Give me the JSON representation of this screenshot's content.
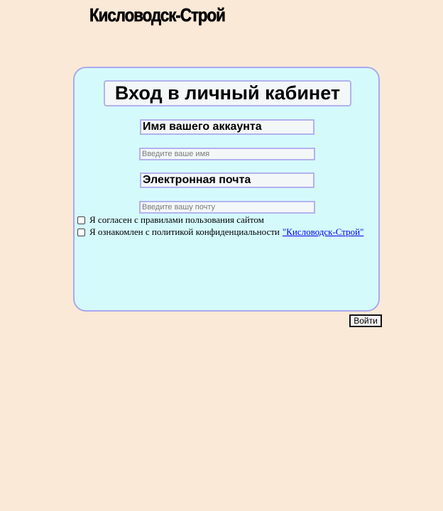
{
  "header": {
    "site_title": "Кисловодск-Строй"
  },
  "login_form": {
    "heading": "Вход в личный кабинет",
    "name_label": "Имя вашего аккаунта",
    "name_placeholder": "Введите ваше имя",
    "name_value": "",
    "email_label": "Электронная почта",
    "email_placeholder": "Введите вашу почту",
    "email_value": "",
    "agree_rules": {
      "label": "Я согласен с правилами пользования сайтом",
      "checked": false
    },
    "agree_privacy": {
      "label": "Я ознакомлен с политикой конфиденциальности",
      "link_text": "\"Кисловодск-Строй\"",
      "checked": false
    },
    "submit_label": "Войти"
  },
  "colors": {
    "page_background": "#fae9d7",
    "panel_background": "#d5fafc",
    "panel_border": "#a9a9f0",
    "field_background": "#f3f7f8",
    "link": "#0000ee"
  }
}
